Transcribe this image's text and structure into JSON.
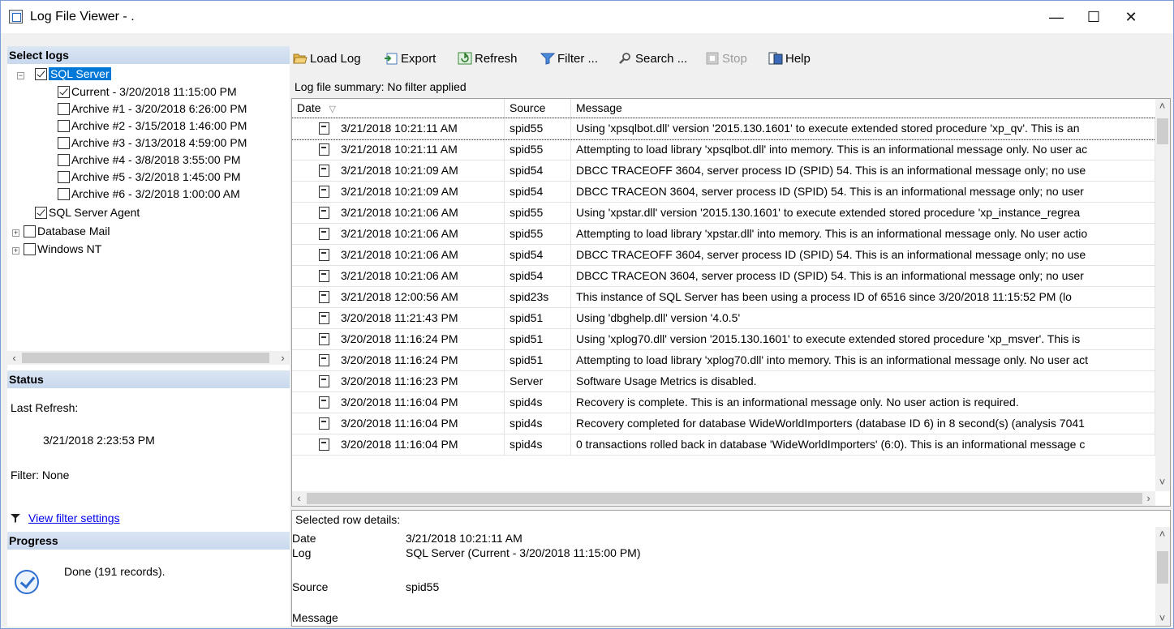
{
  "window": {
    "title": "Log File Viewer - .",
    "minimize": "—",
    "maximize": "☐",
    "close": "✕"
  },
  "left": {
    "select_logs_header": "Select logs",
    "tree": [
      {
        "label": "SQL Server",
        "checked": true,
        "expanded": true
      },
      {
        "label": "Current - 3/20/2018 11:15:00 PM",
        "checked": true
      },
      {
        "label": "Archive #1 - 3/20/2018 6:26:00 PM",
        "checked": false
      },
      {
        "label": "Archive #2 - 3/15/2018 1:46:00 PM",
        "checked": false
      },
      {
        "label": "Archive #3 - 3/13/2018 4:59:00 PM",
        "checked": false
      },
      {
        "label": "Archive #4 - 3/8/2018 3:55:00 PM",
        "checked": false
      },
      {
        "label": "Archive #5 - 3/2/2018 1:45:00 PM",
        "checked": false
      },
      {
        "label": "Archive #6 - 3/2/2018 1:00:00 AM",
        "checked": false
      },
      {
        "label": "SQL Server Agent",
        "checked": true
      },
      {
        "label": "Database Mail",
        "checked": false
      },
      {
        "label": "Windows NT",
        "checked": false
      }
    ],
    "status_header": "Status",
    "last_refresh_label": "Last Refresh:",
    "last_refresh_value": "3/21/2018 2:23:53 PM",
    "filter_text": "Filter: None",
    "view_filter_link": "View filter settings",
    "progress_header": "Progress",
    "progress_text": "Done (191 records)."
  },
  "toolbar": {
    "load_log": "Load Log",
    "export": "Export",
    "refresh": "Refresh",
    "filter": "Filter ...",
    "search": "Search ...",
    "stop": "Stop",
    "help": "Help"
  },
  "summary": "Log file summary: No filter applied",
  "grid": {
    "columns": {
      "date": "Date",
      "source": "Source",
      "message": "Message"
    },
    "rows": [
      {
        "date": "3/21/2018 10:21:11 AM",
        "source": "spid55",
        "message": "Using 'xpsqlbot.dll' version '2015.130.1601' to execute extended stored procedure 'xp_qv'. This is an"
      },
      {
        "date": "3/21/2018 10:21:11 AM",
        "source": "spid55",
        "message": "Attempting to load library 'xpsqlbot.dll' into memory. This is an informational message only. No user ac"
      },
      {
        "date": "3/21/2018 10:21:09 AM",
        "source": "spid54",
        "message": "DBCC TRACEOFF 3604, server process ID (SPID) 54. This is an informational message only; no use"
      },
      {
        "date": "3/21/2018 10:21:09 AM",
        "source": "spid54",
        "message": "DBCC TRACEON 3604, server process ID (SPID) 54. This is an informational message only; no user"
      },
      {
        "date": "3/21/2018 10:21:06 AM",
        "source": "spid55",
        "message": "Using 'xpstar.dll' version '2015.130.1601' to execute extended stored procedure 'xp_instance_regrea"
      },
      {
        "date": "3/21/2018 10:21:06 AM",
        "source": "spid55",
        "message": "Attempting to load library 'xpstar.dll' into memory. This is an informational message only. No user actio"
      },
      {
        "date": "3/21/2018 10:21:06 AM",
        "source": "spid54",
        "message": "DBCC TRACEOFF 3604, server process ID (SPID) 54. This is an informational message only; no use"
      },
      {
        "date": "3/21/2018 10:21:06 AM",
        "source": "spid54",
        "message": "DBCC TRACEON 3604, server process ID (SPID) 54. This is an informational message only; no user"
      },
      {
        "date": "3/21/2018 12:00:56 AM",
        "source": "spid23s",
        "message": "This instance of SQL Server has been using a process ID of 6516 since 3/20/2018 11:15:52 PM (lo"
      },
      {
        "date": "3/20/2018 11:21:43 PM",
        "source": "spid51",
        "message": "Using 'dbghelp.dll' version '4.0.5'"
      },
      {
        "date": "3/20/2018 11:16:24 PM",
        "source": "spid51",
        "message": "Using 'xplog70.dll' version '2015.130.1601' to execute extended stored procedure 'xp_msver'. This is"
      },
      {
        "date": "3/20/2018 11:16:24 PM",
        "source": "spid51",
        "message": "Attempting to load library 'xplog70.dll' into memory. This is an informational message only. No user act"
      },
      {
        "date": "3/20/2018 11:16:23 PM",
        "source": "Server",
        "message": "Software Usage Metrics is disabled."
      },
      {
        "date": "3/20/2018 11:16:04 PM",
        "source": "spid4s",
        "message": "Recovery is complete. This is an informational message only. No user action is required."
      },
      {
        "date": "3/20/2018 11:16:04 PM",
        "source": "spid4s",
        "message": "Recovery completed for database WideWorldImporters (database ID 6) in 8 second(s) (analysis 7041"
      },
      {
        "date": "3/20/2018 11:16:04 PM",
        "source": "spid4s",
        "message": "0 transactions rolled back in database 'WideWorldImporters' (6:0). This is an informational message c"
      }
    ]
  },
  "details": {
    "header": "Selected row details:",
    "date_label": "Date",
    "date_value": "3/21/2018 10:21:11 AM",
    "log_label": "Log",
    "log_value": "SQL Server (Current - 3/20/2018 11:15:00 PM)",
    "source_label": "Source",
    "source_value": "spid55",
    "message_label": "Message"
  }
}
